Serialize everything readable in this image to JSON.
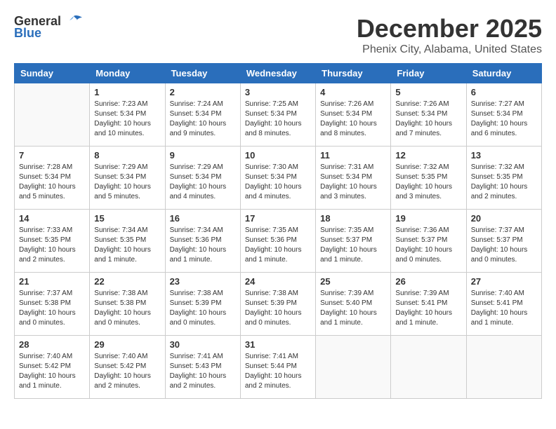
{
  "header": {
    "logo_general": "General",
    "logo_blue": "Blue",
    "month": "December 2025",
    "location": "Phenix City, Alabama, United States"
  },
  "weekdays": [
    "Sunday",
    "Monday",
    "Tuesday",
    "Wednesday",
    "Thursday",
    "Friday",
    "Saturday"
  ],
  "weeks": [
    [
      {
        "day": "",
        "info": ""
      },
      {
        "day": "1",
        "info": "Sunrise: 7:23 AM\nSunset: 5:34 PM\nDaylight: 10 hours\nand 10 minutes."
      },
      {
        "day": "2",
        "info": "Sunrise: 7:24 AM\nSunset: 5:34 PM\nDaylight: 10 hours\nand 9 minutes."
      },
      {
        "day": "3",
        "info": "Sunrise: 7:25 AM\nSunset: 5:34 PM\nDaylight: 10 hours\nand 8 minutes."
      },
      {
        "day": "4",
        "info": "Sunrise: 7:26 AM\nSunset: 5:34 PM\nDaylight: 10 hours\nand 8 minutes."
      },
      {
        "day": "5",
        "info": "Sunrise: 7:26 AM\nSunset: 5:34 PM\nDaylight: 10 hours\nand 7 minutes."
      },
      {
        "day": "6",
        "info": "Sunrise: 7:27 AM\nSunset: 5:34 PM\nDaylight: 10 hours\nand 6 minutes."
      }
    ],
    [
      {
        "day": "7",
        "info": "Sunrise: 7:28 AM\nSunset: 5:34 PM\nDaylight: 10 hours\nand 5 minutes."
      },
      {
        "day": "8",
        "info": "Sunrise: 7:29 AM\nSunset: 5:34 PM\nDaylight: 10 hours\nand 5 minutes."
      },
      {
        "day": "9",
        "info": "Sunrise: 7:29 AM\nSunset: 5:34 PM\nDaylight: 10 hours\nand 4 minutes."
      },
      {
        "day": "10",
        "info": "Sunrise: 7:30 AM\nSunset: 5:34 PM\nDaylight: 10 hours\nand 4 minutes."
      },
      {
        "day": "11",
        "info": "Sunrise: 7:31 AM\nSunset: 5:34 PM\nDaylight: 10 hours\nand 3 minutes."
      },
      {
        "day": "12",
        "info": "Sunrise: 7:32 AM\nSunset: 5:35 PM\nDaylight: 10 hours\nand 3 minutes."
      },
      {
        "day": "13",
        "info": "Sunrise: 7:32 AM\nSunset: 5:35 PM\nDaylight: 10 hours\nand 2 minutes."
      }
    ],
    [
      {
        "day": "14",
        "info": "Sunrise: 7:33 AM\nSunset: 5:35 PM\nDaylight: 10 hours\nand 2 minutes."
      },
      {
        "day": "15",
        "info": "Sunrise: 7:34 AM\nSunset: 5:35 PM\nDaylight: 10 hours\nand 1 minute."
      },
      {
        "day": "16",
        "info": "Sunrise: 7:34 AM\nSunset: 5:36 PM\nDaylight: 10 hours\nand 1 minute."
      },
      {
        "day": "17",
        "info": "Sunrise: 7:35 AM\nSunset: 5:36 PM\nDaylight: 10 hours\nand 1 minute."
      },
      {
        "day": "18",
        "info": "Sunrise: 7:35 AM\nSunset: 5:37 PM\nDaylight: 10 hours\nand 1 minute."
      },
      {
        "day": "19",
        "info": "Sunrise: 7:36 AM\nSunset: 5:37 PM\nDaylight: 10 hours\nand 0 minutes."
      },
      {
        "day": "20",
        "info": "Sunrise: 7:37 AM\nSunset: 5:37 PM\nDaylight: 10 hours\nand 0 minutes."
      }
    ],
    [
      {
        "day": "21",
        "info": "Sunrise: 7:37 AM\nSunset: 5:38 PM\nDaylight: 10 hours\nand 0 minutes."
      },
      {
        "day": "22",
        "info": "Sunrise: 7:38 AM\nSunset: 5:38 PM\nDaylight: 10 hours\nand 0 minutes."
      },
      {
        "day": "23",
        "info": "Sunrise: 7:38 AM\nSunset: 5:39 PM\nDaylight: 10 hours\nand 0 minutes."
      },
      {
        "day": "24",
        "info": "Sunrise: 7:38 AM\nSunset: 5:39 PM\nDaylight: 10 hours\nand 0 minutes."
      },
      {
        "day": "25",
        "info": "Sunrise: 7:39 AM\nSunset: 5:40 PM\nDaylight: 10 hours\nand 1 minute."
      },
      {
        "day": "26",
        "info": "Sunrise: 7:39 AM\nSunset: 5:41 PM\nDaylight: 10 hours\nand 1 minute."
      },
      {
        "day": "27",
        "info": "Sunrise: 7:40 AM\nSunset: 5:41 PM\nDaylight: 10 hours\nand 1 minute."
      }
    ],
    [
      {
        "day": "28",
        "info": "Sunrise: 7:40 AM\nSunset: 5:42 PM\nDaylight: 10 hours\nand 1 minute."
      },
      {
        "day": "29",
        "info": "Sunrise: 7:40 AM\nSunset: 5:42 PM\nDaylight: 10 hours\nand 2 minutes."
      },
      {
        "day": "30",
        "info": "Sunrise: 7:41 AM\nSunset: 5:43 PM\nDaylight: 10 hours\nand 2 minutes."
      },
      {
        "day": "31",
        "info": "Sunrise: 7:41 AM\nSunset: 5:44 PM\nDaylight: 10 hours\nand 2 minutes."
      },
      {
        "day": "",
        "info": ""
      },
      {
        "day": "",
        "info": ""
      },
      {
        "day": "",
        "info": ""
      }
    ]
  ]
}
